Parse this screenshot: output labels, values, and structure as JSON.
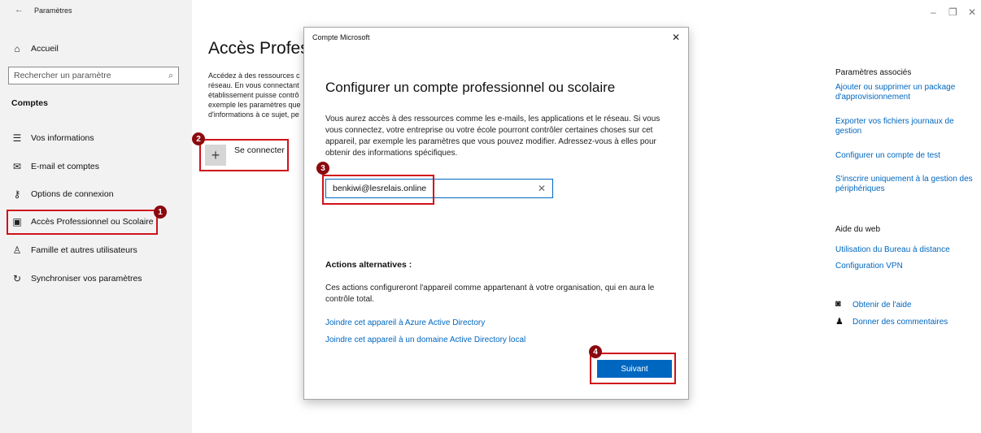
{
  "window": {
    "title": "Paramètres",
    "back_glyph": "←",
    "controls": {
      "minimize": "–",
      "restore": "❐",
      "close": "✕"
    }
  },
  "sidebar": {
    "home": "Accueil",
    "search_placeholder": "Rechercher un paramètre",
    "section": "Comptes",
    "items": [
      {
        "label": "Vos informations",
        "icon": "person-card-icon"
      },
      {
        "label": "E-mail et comptes",
        "icon": "mail-icon"
      },
      {
        "label": "Options de connexion",
        "icon": "key-icon"
      },
      {
        "label": "Accès Professionnel ou Scolaire",
        "icon": "briefcase-icon"
      },
      {
        "label": "Famille et autres utilisateurs",
        "icon": "person-icon"
      },
      {
        "label": "Synchroniser vos paramètres",
        "icon": "sync-icon"
      }
    ]
  },
  "main": {
    "title": "Accès Professi",
    "desc_lines": [
      "Accédez à des ressources c",
      "réseau. En vous connectant",
      "établissement puisse contrô",
      "exemple les paramètres que",
      "d'informations à ce sujet, pe"
    ],
    "connect_label": "Se connecter"
  },
  "dialog": {
    "title": "Compte Microsoft",
    "heading": "Configurer un compte professionnel ou scolaire",
    "description": "Vous aurez accès à des ressources comme les e-mails, les applications et le réseau. Si vous vous connectez, votre entreprise ou votre école pourront contrôler certaines choses sur cet appareil, par exemple les paramètres que vous pouvez modifier. Adressez-vous à elles pour obtenir des informations spécifiques.",
    "email_value": "benkiwi@lesrelais.online",
    "alt_title": "Actions alternatives :",
    "alt_desc": "Ces actions configureront l'appareil comme appartenant à votre organisation, qui en aura le contrôle total.",
    "link_azure": "Joindre cet appareil à Azure Active Directory",
    "link_local": "Joindre cet appareil à un domaine Active Directory local",
    "next_button": "Suivant"
  },
  "right_panel": {
    "related_title": "Paramètres associés",
    "related_links": [
      "Ajouter ou supprimer un package d'approvisionnement",
      "Exporter vos fichiers journaux de gestion",
      "Configurer un compte de test",
      "S'inscrire uniquement à la gestion des périphériques"
    ],
    "web_title": "Aide du web",
    "web_links": [
      "Utilisation du Bureau à distance",
      "Configuration VPN"
    ],
    "help": "Obtenir de l'aide",
    "feedback": "Donner des commentaires"
  },
  "annotations": [
    "1",
    "2",
    "3",
    "4"
  ],
  "colors": {
    "accent": "#0067c0",
    "highlight": "#d0111b",
    "badge": "#8b0a0f"
  }
}
